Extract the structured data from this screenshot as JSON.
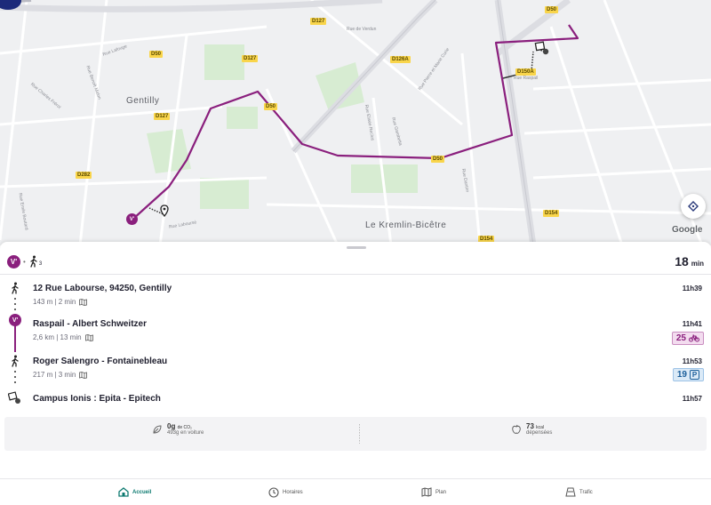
{
  "map": {
    "place_labels": [
      "Gentilly",
      "Le Kremlin-Bicêtre"
    ],
    "road_badges": [
      "D127",
      "D50",
      "D127",
      "D127",
      "D126A",
      "D50",
      "D50",
      "D282",
      "D150A",
      "D154",
      "D154",
      "D50"
    ],
    "street_labels": [
      "Rue Lafouge",
      "Rue Charles Frérot",
      "Rue Benoît Malon",
      "Rue Emile Boutard",
      "Rue de Verdun",
      "Rue Pierre et Marie Curie",
      "Rue Elisée Reclus",
      "Rue Gambetta",
      "Rue Danton",
      "Rue Raspail",
      "Rue Laboursé"
    ],
    "attribution": "Google",
    "buttons": {
      "recenter_icon": "recenter-icon"
    }
  },
  "summary": {
    "mode_badge": "V'",
    "walk_count": "3",
    "duration_value": "18",
    "duration_unit": "min"
  },
  "steps": [
    {
      "kind": "walk",
      "title": "12 Rue Labourse, 94250, Gentilly",
      "sub": "143 m | 2 min",
      "time": "11h39"
    },
    {
      "kind": "bike",
      "title": "Raspail - Albert Schweitzer",
      "sub": "2,6 km | 13 min",
      "time": "11h41",
      "chip_value": "25",
      "chip_icon": "bike-icon"
    },
    {
      "kind": "walk",
      "title": "Roger Salengro - Fontainebleau",
      "sub": "217 m | 3 min",
      "time": "11h53",
      "chip_value": "19",
      "chip_icon": "parking-icon",
      "chip_letter": "P"
    },
    {
      "kind": "destination",
      "title": "Campus Ionis : Epita - Epitech",
      "time": "11h57"
    }
  ],
  "eco": {
    "co2_value": "0g",
    "co2_unit": "de CO₂",
    "co2_compare": "493g en voiture",
    "kcal_value": "73",
    "kcal_unit": "kcal",
    "kcal_label": "dépensées"
  },
  "nav": [
    {
      "label": "Accueil",
      "icon": "home-icon",
      "active": true
    },
    {
      "label": "Horaires",
      "icon": "clock-icon",
      "active": false
    },
    {
      "label": "Plan",
      "icon": "map-icon",
      "active": false
    },
    {
      "label": "Trafic",
      "icon": "traffic-icon",
      "active": false
    }
  ],
  "colors": {
    "route": "#8a1f7d",
    "accent_nav": "#0d7a70",
    "bike_chip": "#f3dcef",
    "parking_chip": "#dbeaf7"
  }
}
